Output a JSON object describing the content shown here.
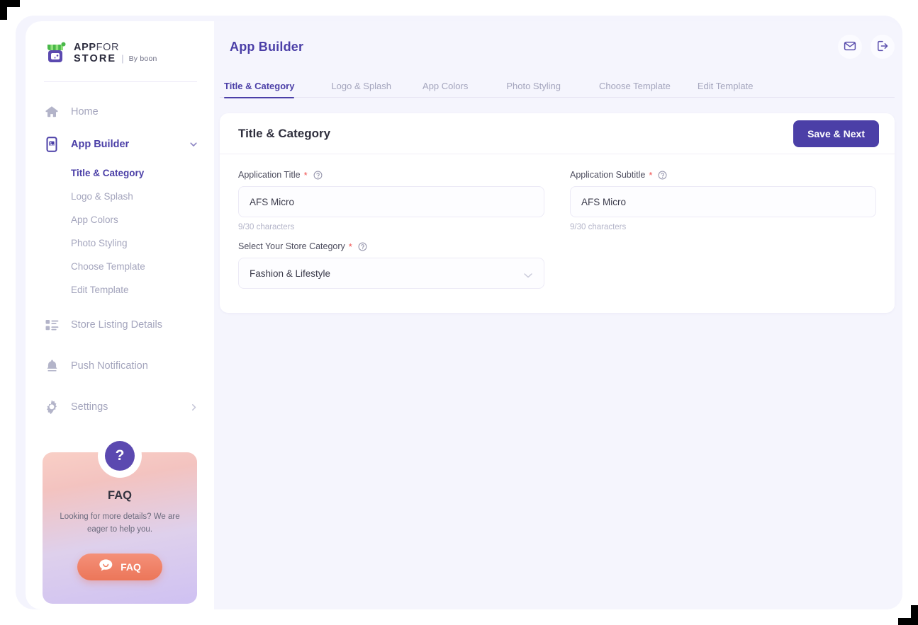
{
  "brand": {
    "line1_bold": "APP",
    "line1_thin": "FOR",
    "line2": "STORE",
    "separator": "|",
    "by": "By boon"
  },
  "sidebar": {
    "items": [
      {
        "label": "Home",
        "icon": "home-icon",
        "active": false
      },
      {
        "label": "App Builder",
        "icon": "app-builder-icon",
        "active": true
      },
      {
        "label": "Store Listing Details",
        "icon": "list-icon",
        "active": false
      },
      {
        "label": "Push Notification",
        "icon": "bell-icon",
        "active": false
      },
      {
        "label": "Settings",
        "icon": "gear-icon",
        "active": false
      }
    ],
    "sub_items": [
      {
        "label": "Title & Category",
        "active": true
      },
      {
        "label": "Logo & Splash",
        "active": false
      },
      {
        "label": "App Colors",
        "active": false
      },
      {
        "label": "Photo Styling",
        "active": false
      },
      {
        "label": "Choose Template",
        "active": false
      },
      {
        "label": "Edit Template",
        "active": false
      }
    ],
    "faq": {
      "badge": "?",
      "title": "FAQ",
      "description": "Looking for more details? We are eager to help you.",
      "button_label": "FAQ"
    }
  },
  "header": {
    "title": "App Builder",
    "mail_icon": "mail-icon",
    "logout_icon": "logout-icon"
  },
  "tabs": [
    {
      "label": "Title & Category",
      "active": true
    },
    {
      "label": "Logo & Splash",
      "active": false
    },
    {
      "label": "App Colors",
      "active": false
    },
    {
      "label": "Photo Styling",
      "active": false
    },
    {
      "label": "Choose Template",
      "active": false
    },
    {
      "label": "Edit Template",
      "active": false
    }
  ],
  "card": {
    "title": "Title & Category",
    "save_label": "Save & Next",
    "fields": {
      "app_title": {
        "label": "Application Title",
        "required": "*",
        "value": "AFS Micro",
        "placeholder": "Application Title",
        "counter": "9/30 characters"
      },
      "app_subtitle": {
        "label": "Application Subtitle",
        "required": "*",
        "value": "AFS Micro",
        "placeholder": "Application Subtitle",
        "counter": "9/30 characters"
      },
      "store_category": {
        "label": "Select Your Store Category",
        "required": "*",
        "value": "Fashion & Lifestyle"
      }
    }
  },
  "colors": {
    "accent": "#4b3fa7",
    "muted": "#a4a5bd",
    "background": "#f5f5fd",
    "required": "#f0504f",
    "faq_button": "#ec7659",
    "logo_green": "#5cc15a",
    "logo_purple": "#5b49b0"
  }
}
